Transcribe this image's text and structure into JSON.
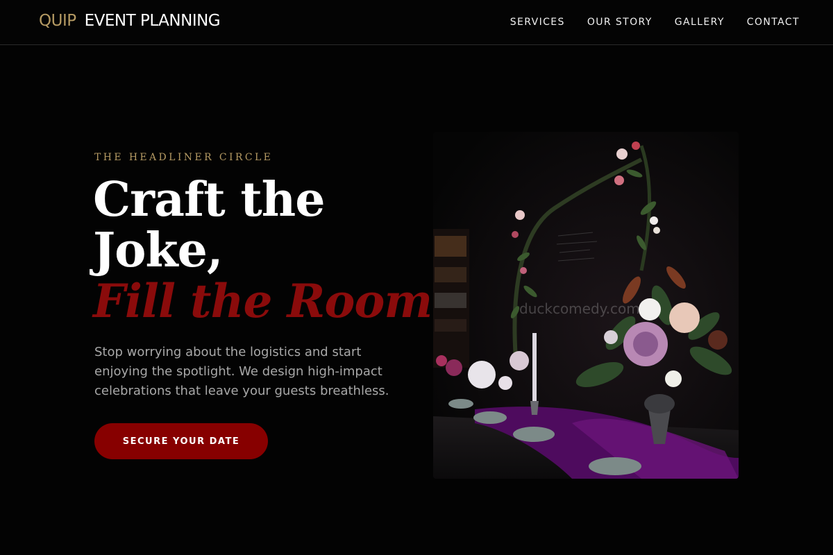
{
  "brand": {
    "accent": "QUIP",
    "rest": "EVENT PLANNING"
  },
  "nav": {
    "items": [
      {
        "label": "SERVICES"
      },
      {
        "label": "OUR STORY"
      },
      {
        "label": "GALLERY"
      },
      {
        "label": "CONTACT"
      }
    ]
  },
  "hero": {
    "eyebrow": "THE HEADLINER CIRCLE",
    "headline_line1": "Craft the",
    "headline_line2": "Joke,",
    "headline_line3": "Fill the Room.",
    "description": "Stop worrying about the logistics and start enjoying the spotlight. We design high-impact celebrations that leave your guests breathless.",
    "cta_label": "SECURE YOUR DATE",
    "photo_watermark": "duckcomedy.com"
  },
  "colors": {
    "background": "#030303",
    "gold_accent": "#b59a63",
    "red_accent": "#870000",
    "text_primary": "#ffffff",
    "text_muted": "#a8a8a8"
  }
}
